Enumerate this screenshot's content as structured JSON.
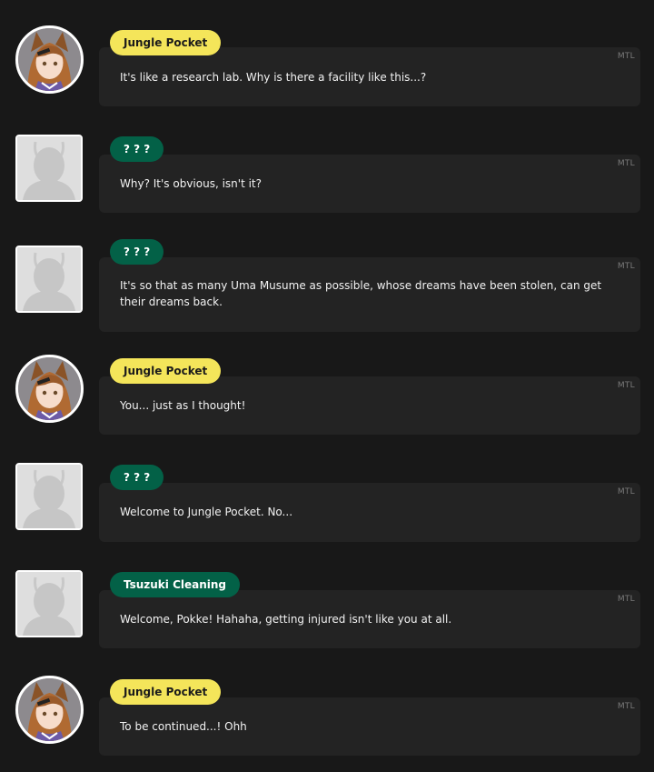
{
  "mtl_label": "MTL",
  "messages": [
    {
      "speaker": "Jungle Pocket",
      "text": "It's like a research lab. Why is there a facility like this...?"
    },
    {
      "speaker": "? ? ?",
      "text": "Why? It's obvious, isn't it?"
    },
    {
      "speaker": "? ? ?",
      "text": "It's so that as many Uma Musume as possible, whose dreams have been stolen, can get their dreams back."
    },
    {
      "speaker": "Jungle Pocket",
      "text": "You... just as I thought!"
    },
    {
      "speaker": "? ? ?",
      "text": "Welcome to Jungle Pocket. No..."
    },
    {
      "speaker": "Tsuzuki Cleaning",
      "text": "Welcome, Pokke! Hahaha, getting injured isn't like you at all."
    },
    {
      "speaker": "Jungle Pocket",
      "text": "To be continued...! Ohh"
    }
  ],
  "colors": {
    "speaker_yellow": "#f4e55a",
    "speaker_green": "#036147",
    "bubble": "#232323",
    "background": "#181818"
  },
  "icons": {
    "character_avatar": "jungle-pocket-portrait",
    "unknown_avatar": "placeholder-silhouette"
  }
}
